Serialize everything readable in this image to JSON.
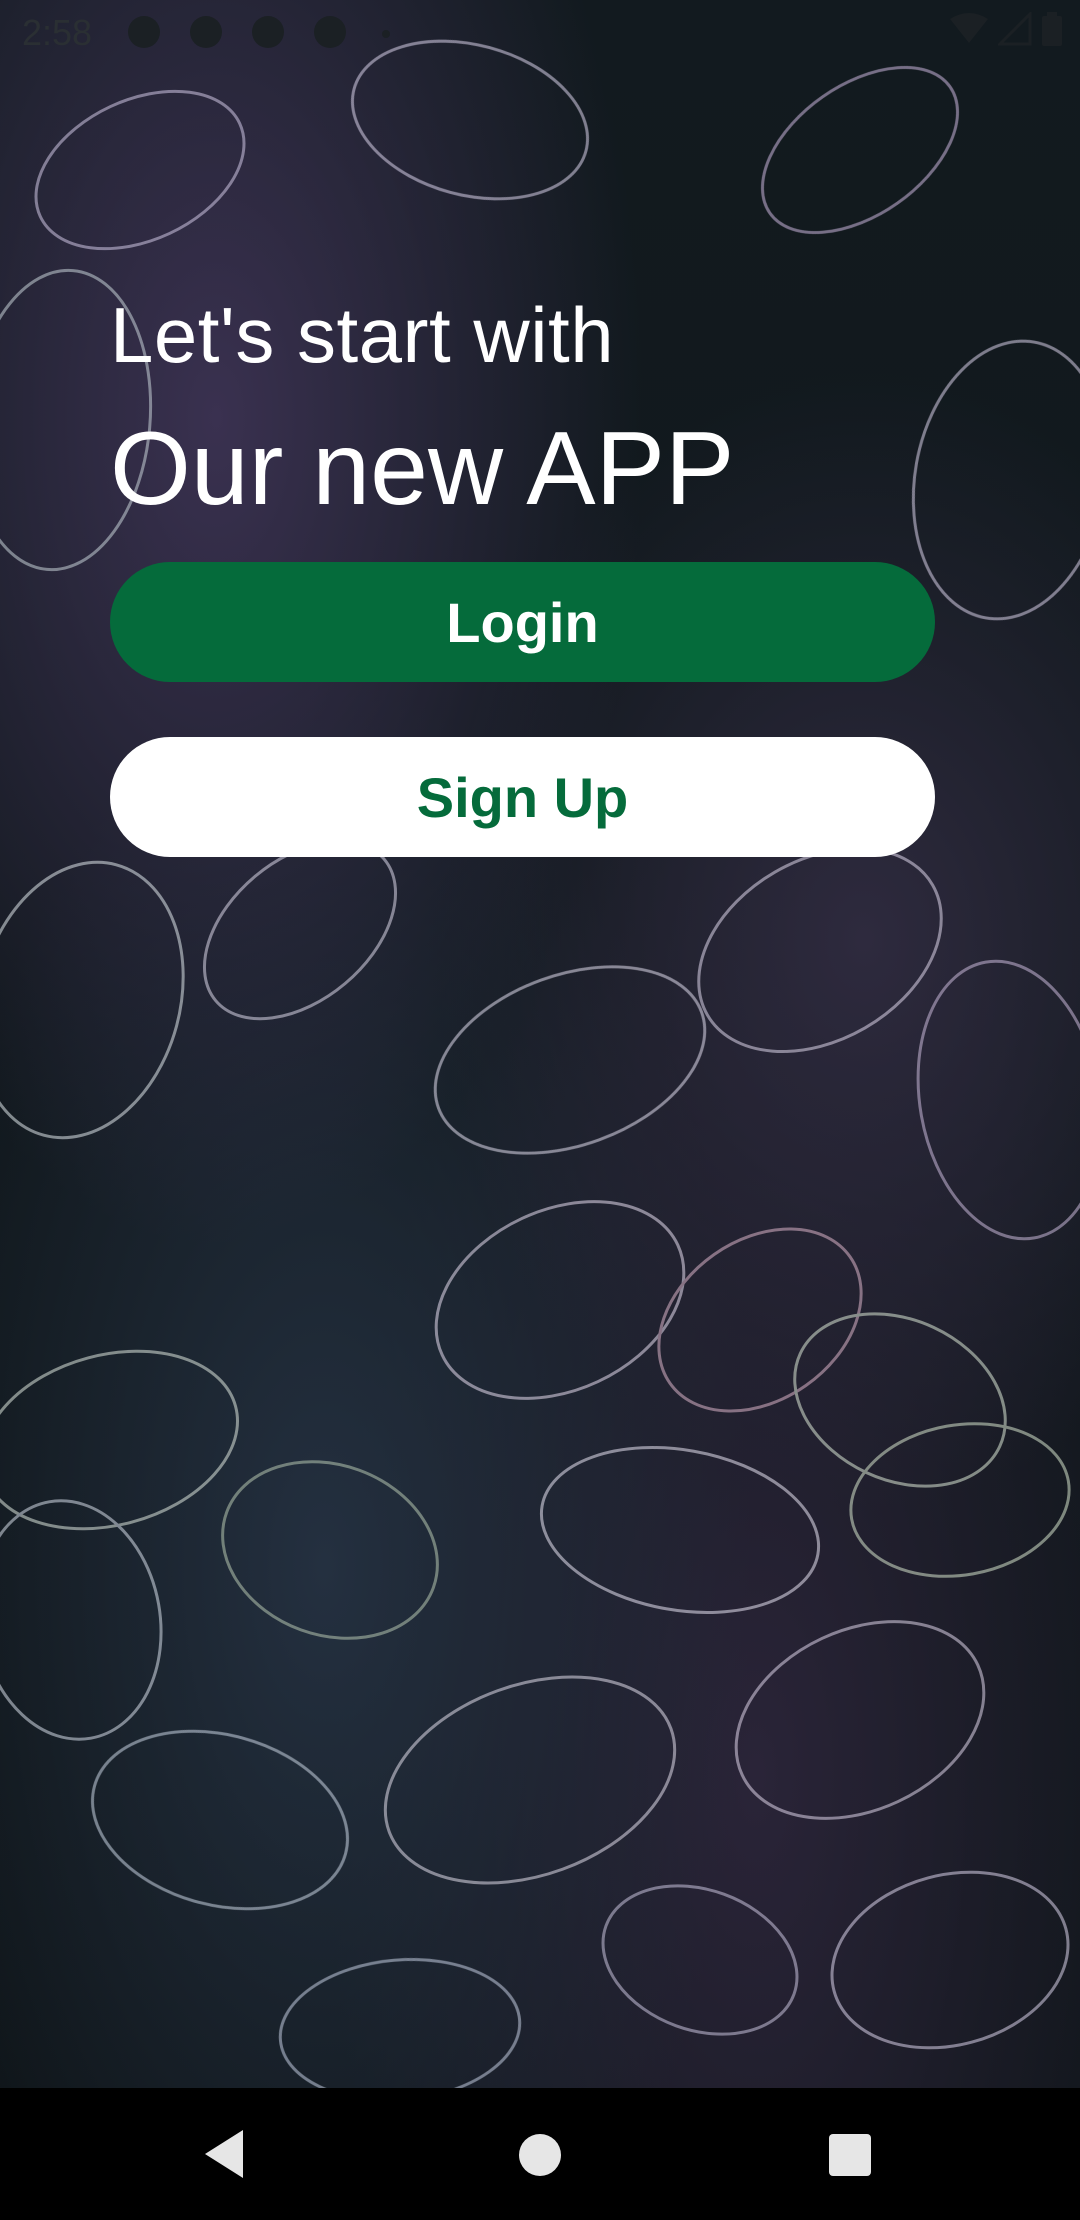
{
  "status_bar": {
    "time": "2:58",
    "left_icons": [
      "settings-icon",
      "app-icon",
      "shield-icon",
      "sync-icon",
      "dot-icon"
    ],
    "right_icons": [
      "wifi-icon",
      "signal-icon",
      "battery-icon"
    ]
  },
  "hero": {
    "subtitle": "Let's start with",
    "title": "Our new APP"
  },
  "buttons": {
    "login_label": "Login",
    "signup_label": "Sign Up"
  },
  "colors": {
    "brand_green": "#056b3b",
    "white": "#ffffff",
    "nav_bar": "#000000"
  },
  "background": {
    "image": "dark-leaves-background"
  },
  "nav_bar": {
    "icons": [
      "back-icon",
      "home-icon",
      "recents-icon"
    ]
  }
}
